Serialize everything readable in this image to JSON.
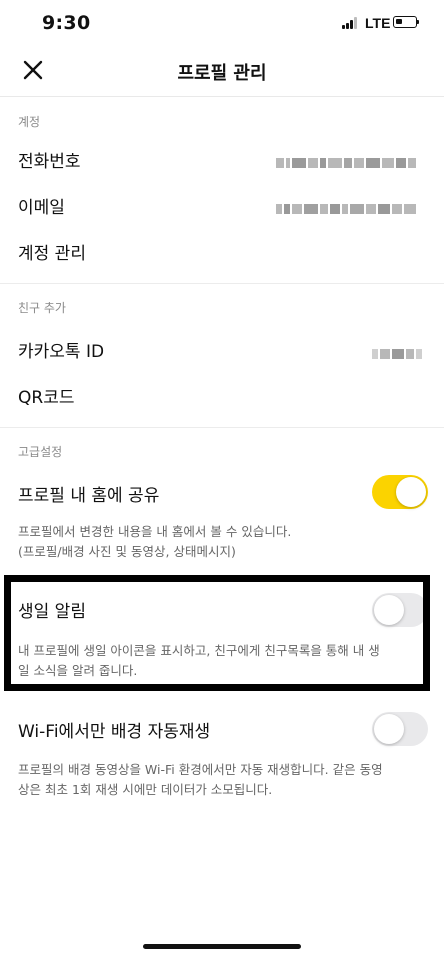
{
  "status_bar": {
    "time": "9:30",
    "network": "LTE"
  },
  "nav": {
    "title": "프로필 관리",
    "close_icon": "close-icon"
  },
  "sections": {
    "account": {
      "label": "계정",
      "phone_label": "전화번호",
      "email_label": "이메일",
      "manage_label": "계정 관리"
    },
    "add_friend": {
      "label": "친구 추가",
      "kakao_id_label": "카카오톡 ID",
      "qr_label": "QR코드"
    },
    "advanced": {
      "label": "고급설정",
      "share_label": "프로필 내 홈에 공유",
      "share_on": true,
      "share_desc_1": "프로필에서 변경한 내용을 내 홈에서 볼 수 있습니다.",
      "share_desc_2": "(프로필/배경 사진 및 동영상, 상태메시지)",
      "birthday_label": "생일 알림",
      "birthday_on": false,
      "birthday_desc_1": "내 프로필에 생일 아이콘을 표시하고, 친구에게 친구목록을 통해 내 생",
      "birthday_desc_2": "일 소식을 알려 줍니다.",
      "wifi_label": "Wi-Fi에서만 배경 자동재생",
      "wifi_on": false,
      "wifi_desc_1": "프로필의 배경 동영상을 Wi-Fi 환경에서만 자동 재생합니다. 같은 동영",
      "wifi_desc_2": "상은 최초 1회 재생 시에만 데이터가 소모됩니다."
    }
  },
  "colors": {
    "toggle_on": "#fbd300",
    "toggle_off": "#e9e9eb",
    "highlight_border": "#000000"
  }
}
